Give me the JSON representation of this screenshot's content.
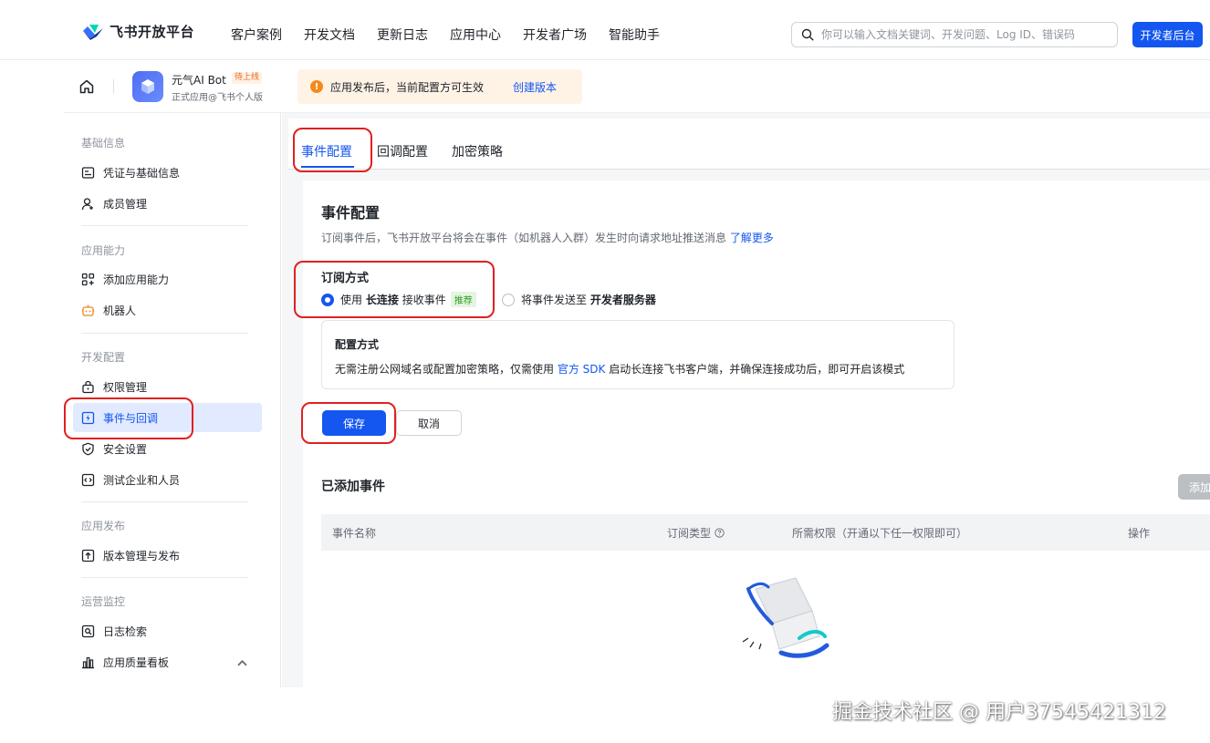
{
  "topnav": {
    "brand": "飞书开放平台",
    "links": [
      "客户案例",
      "开发文档",
      "更新日志",
      "应用中心",
      "开发者广场",
      "智能助手"
    ],
    "search_placeholder": "你可以输入文档关键词、开发问题、Log ID、错误码",
    "dev_button": "开发者后台"
  },
  "app": {
    "name": "元气AI Bot",
    "badge": "待上线",
    "sub": "正式应用@飞书个人版",
    "notice": "应用发布后，当前配置方可生效",
    "notice_link": "创建版本"
  },
  "sidebar": {
    "groups": [
      "基础信息",
      "应用能力",
      "开发配置",
      "应用发布",
      "运营监控"
    ],
    "items": [
      {
        "label": "凭证与基础信息",
        "icon": "credential-icon"
      },
      {
        "label": "成员管理",
        "icon": "member-icon"
      },
      {
        "label": "添加应用能力",
        "icon": "apps-add-icon"
      },
      {
        "label": "机器人",
        "icon": "robot-icon"
      },
      {
        "label": "权限管理",
        "icon": "permission-icon"
      },
      {
        "label": "事件与回调",
        "icon": "event-icon",
        "active": true
      },
      {
        "label": "安全设置",
        "icon": "shield-icon"
      },
      {
        "label": "测试企业和人员",
        "icon": "test-icon"
      },
      {
        "label": "版本管理与发布",
        "icon": "upload-icon"
      },
      {
        "label": "日志检索",
        "icon": "log-search-icon"
      },
      {
        "label": "应用质量看板",
        "icon": "bar-chart-icon"
      }
    ]
  },
  "tabs": [
    "事件配置",
    "回调配置",
    "加密策略"
  ],
  "event_config": {
    "title": "事件配置",
    "desc": "订阅事件后，飞书开放平台将会在事件（如机器人入群）发生时向请求地址推送消息",
    "desc_link": "了解更多",
    "subscribe_label": "订阅方式",
    "option1_a": "使用",
    "option1_b": "长连接",
    "option1_c": "接收事件",
    "option1_tag": "推荐",
    "option2_a": "将事件发送至",
    "option2_b": "开发者服务器",
    "info_title": "配置方式",
    "info_text_a": "无需注册公网域名或配置加密策略，仅需使用",
    "info_link": "官方 SDK",
    "info_text_b": "启动长连接飞书客户端，并确保连接成功后，即可开启该模式",
    "save": "保存",
    "cancel": "取消"
  },
  "added_events": {
    "title": "已添加事件",
    "add_button": "添加",
    "columns": [
      "事件名称",
      "订阅类型",
      "所需权限（开通以下任一权限即可）",
      "操作"
    ]
  },
  "watermark": "掘金技术社区 @ 用户37545421312",
  "colors": {
    "accent": "#1456f0",
    "highlight": "#e02020",
    "warning": "#f58a1f",
    "recommend": "#2ea121"
  }
}
